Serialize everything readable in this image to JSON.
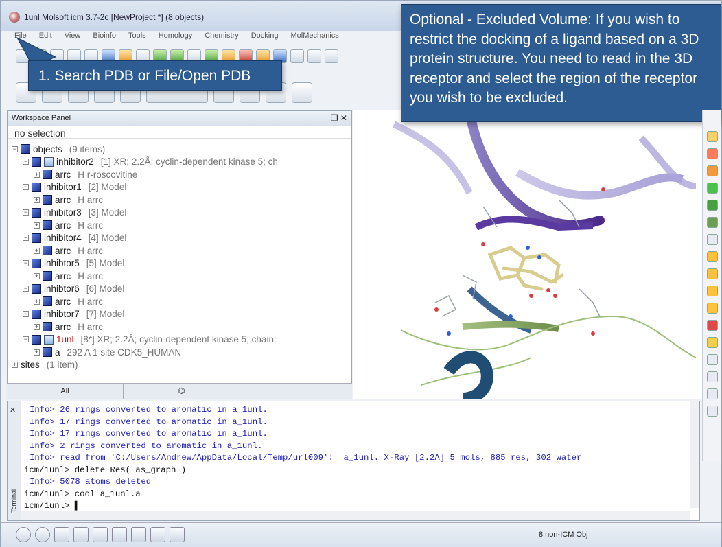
{
  "window": {
    "title": "1unl Molsoft icm 3.7-2c  [NewProject *] (8 objects)"
  },
  "menu": [
    "File",
    "Edit",
    "View",
    "Bioinfo",
    "Tools",
    "Homology",
    "Chemistry",
    "Docking",
    "MolMechanics"
  ],
  "callouts": {
    "search": "1. Search PDB or File/Open PDB",
    "excluded": "Optional - Excluded Volume: If you wish to restrict the docking of a ligand based on a 3D protein structure. You need to read in the 3D receptor and select the region of the receptor you wish to be excluded."
  },
  "workspace": {
    "title": "Workspace Panel",
    "selection": "no selection",
    "tabs": [
      "All"
    ],
    "tree": [
      {
        "level": 0,
        "exp": "−",
        "name": "objects",
        "desc": "(9 items)"
      },
      {
        "level": 1,
        "exp": "−",
        "name": "inhibitor2",
        "desc": "[1] XR; 2.2Å; cyclin-dependent kinase 5; ch",
        "pdb": true
      },
      {
        "level": 2,
        "exp": "+",
        "name": "arrc",
        "desc": "H   r-roscovitine"
      },
      {
        "level": 1,
        "exp": "−",
        "name": "inhibitor1",
        "desc": "[2] Model"
      },
      {
        "level": 2,
        "exp": "+",
        "name": "arrc",
        "desc": "H   arrc"
      },
      {
        "level": 1,
        "exp": "−",
        "name": "inhibitor3",
        "desc": "[3] Model"
      },
      {
        "level": 2,
        "exp": "+",
        "name": "arrc",
        "desc": "H   arrc"
      },
      {
        "level": 1,
        "exp": "−",
        "name": "inhibitor4",
        "desc": "[4] Model"
      },
      {
        "level": 2,
        "exp": "+",
        "name": "arrc",
        "desc": "H   arrc"
      },
      {
        "level": 1,
        "exp": "−",
        "name": "inhibtor5",
        "desc": "[5] Model"
      },
      {
        "level": 2,
        "exp": "+",
        "name": "arrc",
        "desc": "H   arrc"
      },
      {
        "level": 1,
        "exp": "−",
        "name": "inhibtor6",
        "desc": "[6] Model"
      },
      {
        "level": 2,
        "exp": "+",
        "name": "arrc",
        "desc": "H   arrc"
      },
      {
        "level": 1,
        "exp": "−",
        "name": "inhibtor7",
        "desc": "[7] Model"
      },
      {
        "level": 2,
        "exp": "+",
        "name": "arrc",
        "desc": "H   arrc"
      },
      {
        "level": 1,
        "exp": "−",
        "name": "1unl",
        "desc": "[8*] XR; 2.2Å; cyclin-dependent kinase 5; chain:",
        "pdb": true,
        "red": true
      },
      {
        "level": 2,
        "exp": "+",
        "name": "a",
        "desc": "292 A  1 site CDK5_HUMAN"
      },
      {
        "level": 0,
        "exp": "+",
        "name": "sites",
        "desc": "(1 item)",
        "noicon": true
      }
    ]
  },
  "terminal": {
    "side_label": "Terminal",
    "lines": [
      {
        "type": "info",
        "text": "Info> 26 rings converted to aromatic in a_1unl."
      },
      {
        "type": "info",
        "text": "Info> 17 rings converted to aromatic in a_1unl."
      },
      {
        "type": "info",
        "text": "Info> 17 rings converted to aromatic in a_1unl."
      },
      {
        "type": "info",
        "text": "Info> 2 rings converted to aromatic in a_1unl."
      },
      {
        "type": "info",
        "text": "Info> read from 'C:/Users/Andrew/AppData/Local/Temp/url009':  a_1unl. X-Ray [2.2A] 5 mols, 885 res, 302 water"
      },
      {
        "type": "cmd",
        "text": "icm/1unl> delete Res( as_graph )"
      },
      {
        "type": "info",
        "text": "Info> 5078 atoms deleted"
      },
      {
        "type": "cmd",
        "text": "icm/1unl> cool a_1unl.a"
      },
      {
        "type": "cmd",
        "text": "icm/1unl> ▌"
      }
    ]
  },
  "status": {
    "text": "8 non-ICM Obj"
  }
}
